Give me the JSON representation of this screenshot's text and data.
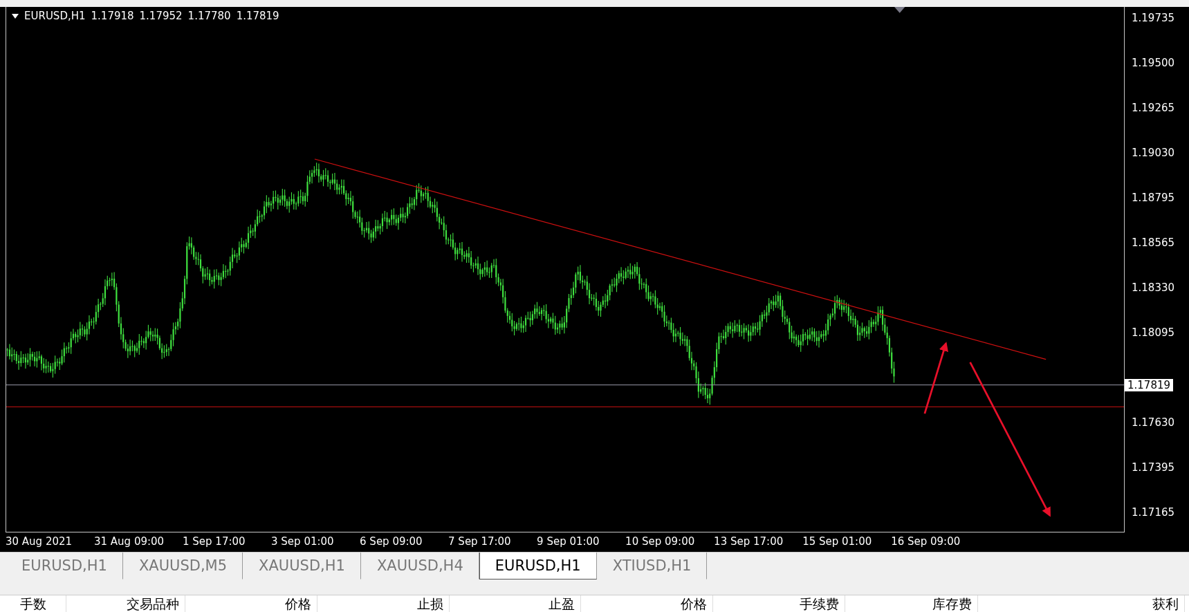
{
  "chart": {
    "symbol": "EURUSD,H1",
    "ohlc": [
      "1.17918",
      "1.17952",
      "1.17780",
      "1.17819"
    ],
    "current_price": "1.17819",
    "y_axis": [
      "1.19735",
      "1.19500",
      "1.19265",
      "1.19030",
      "1.18795",
      "1.18565",
      "1.18330",
      "1.18095",
      "1.17630",
      "1.17395",
      "1.17165"
    ],
    "x_axis": [
      "30 Aug 2021",
      "31 Aug 09:00",
      "1 Sep 17:00",
      "3 Sep 01:00",
      "6 Sep 09:00",
      "7 Sep 17:00",
      "9 Sep 01:00",
      "10 Sep 09:00",
      "13 Sep 17:00",
      "15 Sep 01:00",
      "16 Sep 09:00"
    ]
  },
  "tabs": [
    {
      "label": "EURUSD,H1",
      "selected": false
    },
    {
      "label": "XAUUSD,M5",
      "selected": false
    },
    {
      "label": "XAUUSD,H1",
      "selected": false
    },
    {
      "label": "XAUUSD,H4",
      "selected": false
    },
    {
      "label": "EURUSD,H1",
      "selected": true
    },
    {
      "label": "XTIUSD,H1",
      "selected": false
    }
  ],
  "table": {
    "columns": [
      "手数",
      "交易品种",
      "价格",
      "止损",
      "止盈",
      "价格",
      "手续费",
      "库存费",
      "获利"
    ]
  }
}
